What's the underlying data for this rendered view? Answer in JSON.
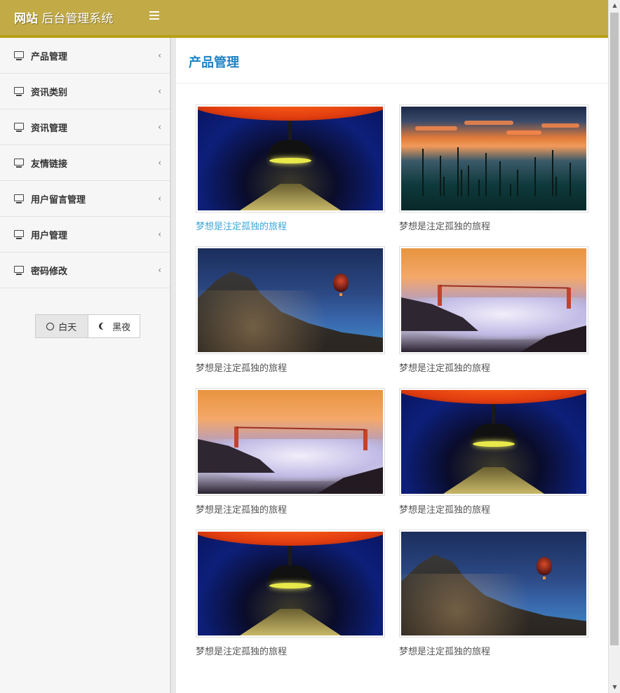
{
  "header": {
    "brand_bold": "网站",
    "brand_rest": "后台管理系统",
    "bar_color": "#c2ab47",
    "menu_toggle_icon": "hamburger-icon"
  },
  "sidebar": {
    "items": [
      {
        "label": "产品管理",
        "icon": "monitor-icon",
        "chevron": "‹"
      },
      {
        "label": "资讯类别",
        "icon": "monitor-icon",
        "chevron": "‹"
      },
      {
        "label": "资讯管理",
        "icon": "monitor-icon",
        "chevron": "‹"
      },
      {
        "label": "友情链接",
        "icon": "monitor-icon",
        "chevron": "‹"
      },
      {
        "label": "用户留言管理",
        "icon": "monitor-icon",
        "chevron": "‹"
      },
      {
        "label": "用户管理",
        "icon": "monitor-icon",
        "chevron": "‹"
      },
      {
        "label": "密码修改",
        "icon": "monitor-icon",
        "chevron": "‹"
      }
    ],
    "theme": {
      "day_label": "白天",
      "night_label": "黑夜",
      "selected": "白天"
    }
  },
  "main": {
    "title": "产品管理",
    "title_color": "#1e82c3",
    "cards": [
      {
        "caption": "梦想是注定孤独的旅程",
        "scene": "subway",
        "highlighted": true
      },
      {
        "caption": "梦想是注定孤独的旅程",
        "scene": "lake"
      },
      {
        "caption": "梦想是注定孤独的旅程",
        "scene": "village"
      },
      {
        "caption": "梦想是注定孤独的旅程",
        "scene": "bridge"
      },
      {
        "caption": "梦想是注定孤独的旅程",
        "scene": "bridge"
      },
      {
        "caption": "梦想是注定孤独的旅程",
        "scene": "subway"
      },
      {
        "caption": "梦想是注定孤独的旅程",
        "scene": "subway"
      },
      {
        "caption": "梦想是注定孤独的旅程",
        "scene": "village"
      }
    ]
  }
}
